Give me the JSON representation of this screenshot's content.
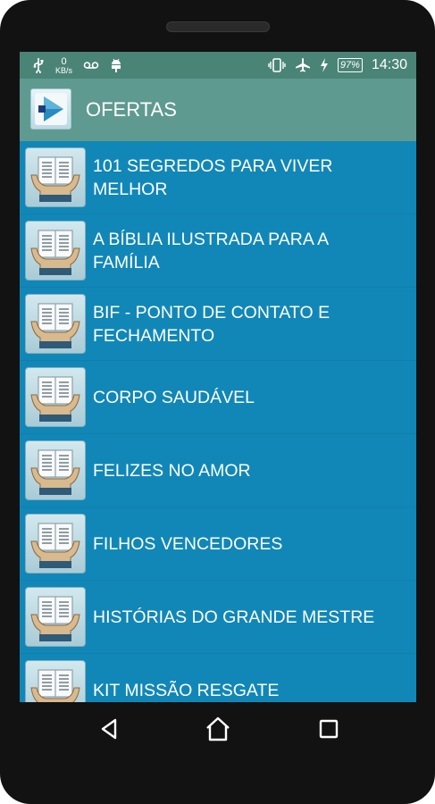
{
  "status_bar": {
    "left_icons": [
      "usb-icon",
      "data-speed-icon",
      "voicemail-icon",
      "android-debug-icon"
    ],
    "data_speed": {
      "value": "0",
      "unit": "KB/s"
    },
    "right_icons": [
      "vibrate-icon",
      "airplane-icon",
      "charging-icon"
    ],
    "battery": "97%",
    "time": "14:30"
  },
  "action_bar": {
    "title": "OFERTAS",
    "logo_icon": "play-arrow-logo-icon"
  },
  "list": {
    "items": [
      {
        "label": "101 SEGREDOS PARA VIVER MELHOR",
        "icon": "open-book-hands-icon"
      },
      {
        "label": "A BÍBLIA ILUSTRADA PARA A FAMÍLIA",
        "icon": "open-book-hands-icon"
      },
      {
        "label": "BIF - PONTO DE CONTATO E FECHAMENTO",
        "icon": "open-book-hands-icon"
      },
      {
        "label": "CORPO SAUDÁVEL",
        "icon": "open-book-hands-icon"
      },
      {
        "label": "FELIZES NO AMOR",
        "icon": "open-book-hands-icon"
      },
      {
        "label": "FILHOS VENCEDORES",
        "icon": "open-book-hands-icon"
      },
      {
        "label": "HISTÓRIAS DO GRANDE MESTRE",
        "icon": "open-book-hands-icon"
      },
      {
        "label": "KIT MISSÃO RESGATE",
        "icon": "open-book-hands-icon"
      }
    ]
  },
  "nav_bar": {
    "buttons": [
      "back-icon",
      "home-icon",
      "recents-icon"
    ]
  },
  "colors": {
    "status_bar": "#4a8476",
    "action_bar": "#5f9a90",
    "list_background": "#1187b7",
    "device": "#121212"
  }
}
